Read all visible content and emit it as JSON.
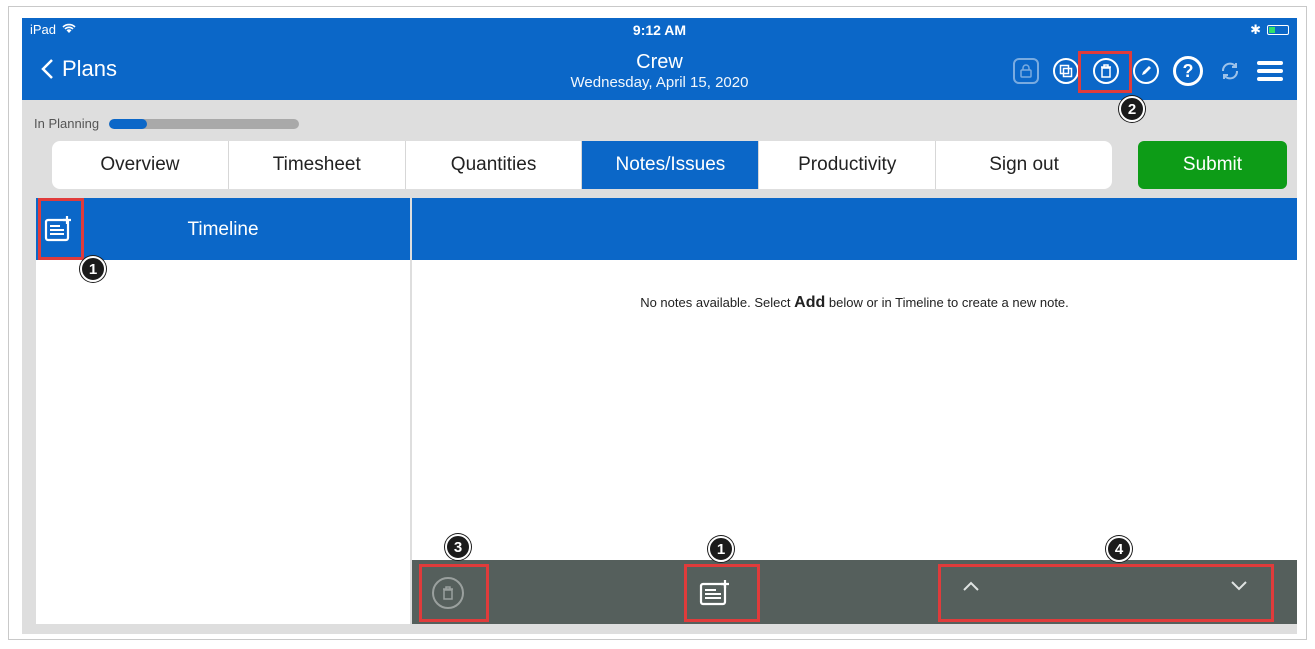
{
  "status_bar": {
    "device": "iPad",
    "time": "9:12 AM",
    "bluetooth": "✱"
  },
  "header": {
    "back_label": "Plans",
    "title": "Crew",
    "date": "Wednesday, April 15, 2020",
    "actions": [
      "lock-icon",
      "copy-icon",
      "trash-icon",
      "edit-icon",
      "help-icon",
      "sync-icon",
      "menu-icon"
    ]
  },
  "progress": {
    "label": "In Planning",
    "fraction": 0.2
  },
  "tabs": [
    {
      "label": "Overview"
    },
    {
      "label": "Timesheet"
    },
    {
      "label": "Quantities"
    },
    {
      "label": "Notes/Issues",
      "active": true
    },
    {
      "label": "Productivity"
    },
    {
      "label": "Sign out"
    }
  ],
  "submit_label": "Submit",
  "timeline": {
    "label": "Timeline"
  },
  "notes": {
    "empty_prefix": "No notes available. Select ",
    "empty_bold": "Add",
    "empty_suffix": " below or in Timeline to create a new note."
  },
  "callouts": {
    "one": "1",
    "two": "2",
    "three": "3",
    "four": "4"
  },
  "colors": {
    "brand": "#0b67c8",
    "submit": "#0d9c17",
    "highlight": "#e03b3b",
    "bottom_bar": "#555f5c"
  }
}
